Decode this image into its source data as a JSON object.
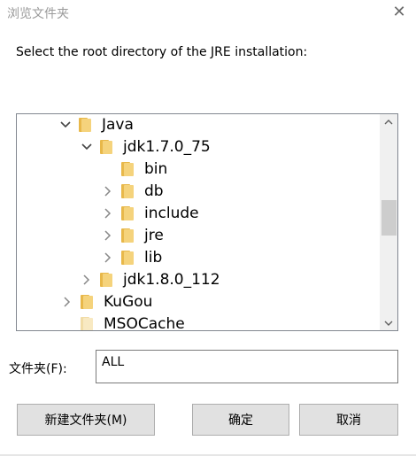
{
  "window": {
    "title": "浏览文件夹",
    "close_glyph": "✕"
  },
  "prompt": "Select the root directory of the JRE installation:",
  "tree": {
    "items": [
      {
        "label": "Java",
        "expander": "expanded",
        "faded": false
      },
      {
        "label": "jdk1.7.0_75",
        "expander": "expanded",
        "faded": false
      },
      {
        "label": "bin",
        "expander": "none",
        "faded": false
      },
      {
        "label": "db",
        "expander": "collapsed",
        "faded": false
      },
      {
        "label": "include",
        "expander": "collapsed",
        "faded": false
      },
      {
        "label": "jre",
        "expander": "collapsed",
        "faded": false
      },
      {
        "label": "lib",
        "expander": "collapsed",
        "faded": false
      },
      {
        "label": "jdk1.8.0_112",
        "expander": "collapsed",
        "faded": false
      },
      {
        "label": "KuGou",
        "expander": "collapsed",
        "faded": false
      },
      {
        "label": "MSOCache",
        "expander": "none",
        "faded": true
      }
    ],
    "scroll_position": 0.47
  },
  "folder_field": {
    "label": "文件夹(F):",
    "value": "ALL"
  },
  "buttons": {
    "new_folder": "新建文件夹(M)",
    "ok": "确定",
    "cancel": "取消"
  },
  "colors": {
    "folder": "#f5d37c",
    "button_bg": "#e1e1e1",
    "scroll_thumb": "#cdcdcd"
  }
}
